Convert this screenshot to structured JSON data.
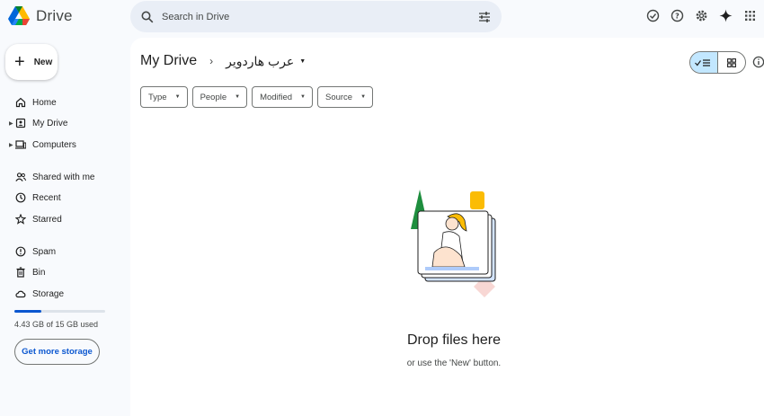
{
  "app": {
    "name": "Drive"
  },
  "search": {
    "placeholder": "Search in Drive"
  },
  "top_icons": [
    "offline-ready-icon",
    "help-icon",
    "settings-icon",
    "gemini-icon",
    "apps-grid-icon"
  ],
  "sidebar": {
    "new_label": "New",
    "items": [
      {
        "label": "Home",
        "icon": "home-icon"
      },
      {
        "label": "My Drive",
        "icon": "my-drive-icon"
      },
      {
        "label": "Computers",
        "icon": "computers-icon"
      },
      {
        "label": "Shared with me",
        "icon": "shared-icon"
      },
      {
        "label": "Recent",
        "icon": "clock-icon"
      },
      {
        "label": "Starred",
        "icon": "star-icon"
      },
      {
        "label": "Spam",
        "icon": "spam-icon"
      },
      {
        "label": "Bin",
        "icon": "bin-icon"
      },
      {
        "label": "Storage",
        "icon": "cloud-icon"
      }
    ],
    "storage": {
      "used_fraction": 0.295,
      "text": "4.43 GB of 15 GB used"
    },
    "get_more_storage": "Get more storage"
  },
  "main": {
    "breadcrumb_root": "My Drive",
    "breadcrumb_current": "عرب هاردوير",
    "filters": [
      "Type",
      "People",
      "Modified",
      "Source"
    ],
    "empty_title": "Drop files here",
    "empty_subtitle": "or use the 'New' button."
  },
  "colors": {
    "accent": "#0b57d0",
    "selected_toggle": "#c2e7ff",
    "search_bg": "#e9eef6",
    "page_bg": "#f8fafd"
  }
}
